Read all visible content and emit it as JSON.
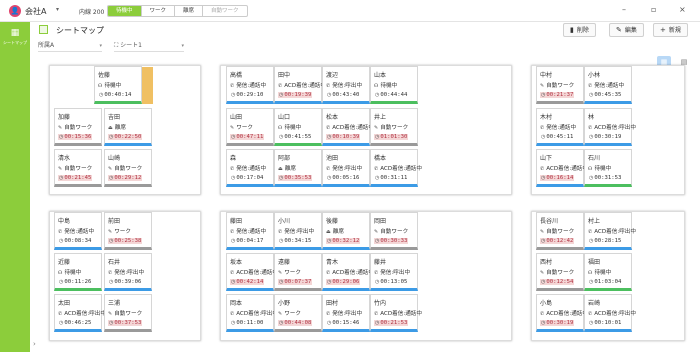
{
  "topbar": {
    "company_icon": "person-icon",
    "company_name": "会社A",
    "company_caret": "▾",
    "extension": "内線 200",
    "status_tabs": [
      "待機中",
      "ワーク",
      "離席",
      "自動ワーク"
    ],
    "active_status": "待機中",
    "window_buttons": [
      "–",
      "▫",
      "×"
    ]
  },
  "rail": {
    "label": "シートマップ",
    "icon": "grid-icon"
  },
  "header": {
    "title": "シートマップ",
    "buttons": [
      {
        "label": "削除",
        "icon": "trash-icon",
        "glyph": "▮"
      },
      {
        "label": "編集",
        "icon": "pencil-icon",
        "glyph": "✎"
      },
      {
        "label": "新規",
        "icon": "plus-icon",
        "glyph": "+"
      }
    ]
  },
  "filters": {
    "group": "所属A",
    "sheet": "シート1",
    "sheet_icon": "org-icon"
  },
  "status_colors": {
    "work": "#9a9a9a",
    "talk": "#3c9be6",
    "wait": "#4cbf5f",
    "alert_bg": "#f4d6d6"
  },
  "cards": [
    {
      "name": "佐藤",
      "status": "待機中",
      "time": "00:40:14",
      "type": "wait",
      "alert": false,
      "highlight": true
    },
    {
      "name": "加藤",
      "status": "自動ワーク",
      "time": "00:15:36",
      "type": "work",
      "alert": true
    },
    {
      "name": "吉田",
      "status": "離席",
      "time": "00:22:50",
      "type": "rest",
      "alert": true
    },
    {
      "name": "清水",
      "status": "自動ワーク",
      "time": "00:21:45",
      "type": "work",
      "alert": true
    },
    {
      "name": "山崎",
      "status": "自動ワーク",
      "time": "00:29:12",
      "type": "work",
      "alert": true
    },
    {
      "name": "高橋",
      "status": "発信:通話中",
      "time": "00:29:10",
      "type": "talk",
      "alert": false
    },
    {
      "name": "田中",
      "status": "ACD着信:通話中",
      "time": "00:19:39",
      "type": "talk",
      "alert": true
    },
    {
      "name": "渡辺",
      "status": "発信:呼出中",
      "time": "00:43:40",
      "type": "talk",
      "alert": false
    },
    {
      "name": "山本",
      "status": "待機中",
      "time": "00:44:44",
      "type": "wait",
      "alert": false
    },
    {
      "name": "山田",
      "status": "ワーク",
      "time": "00:47:11",
      "type": "work",
      "alert": true
    },
    {
      "name": "山口",
      "status": "待機中",
      "time": "00:41:55",
      "type": "wait",
      "alert": false
    },
    {
      "name": "松本",
      "status": "ACD着信:通話中",
      "time": "00:10:39",
      "type": "talk",
      "alert": true
    },
    {
      "name": "井上",
      "status": "自動ワーク",
      "time": "01:01:30",
      "type": "work",
      "alert": true
    },
    {
      "name": "森",
      "status": "発信:通話中",
      "time": "00:17:04",
      "type": "talk",
      "alert": false
    },
    {
      "name": "阿部",
      "status": "離席",
      "time": "00:35:53",
      "type": "rest",
      "alert": true
    },
    {
      "name": "池田",
      "status": "発信:呼出中",
      "time": "00:05:16",
      "type": "talk",
      "alert": false
    },
    {
      "name": "橋本",
      "status": "ACD着信:通話中",
      "time": "00:31:11",
      "type": "talk",
      "alert": false
    },
    {
      "name": "中村",
      "status": "自動ワーク",
      "time": "00:21:37",
      "type": "work",
      "alert": true
    },
    {
      "name": "小林",
      "status": "発信:通話中",
      "time": "00:45:35",
      "type": "talk",
      "alert": false
    },
    {
      "name": "木村",
      "status": "発信:通話中",
      "time": "00:45:11",
      "type": "talk",
      "alert": false
    },
    {
      "name": "林",
      "status": "ACD着信:呼出中",
      "time": "00:30:19",
      "type": "talk",
      "alert": false
    },
    {
      "name": "山下",
      "status": "ACD着信:通話中",
      "time": "00:16:14",
      "type": "talk",
      "alert": true
    },
    {
      "name": "石川",
      "status": "待機中",
      "time": "00:31:53",
      "type": "wait",
      "alert": false
    },
    {
      "name": "中島",
      "status": "発信:通話中",
      "time": "00:08:34",
      "type": "talk",
      "alert": false
    },
    {
      "name": "前田",
      "status": "ワーク",
      "time": "00:25:38",
      "type": "work",
      "alert": true
    },
    {
      "name": "近藤",
      "status": "待機中",
      "time": "00:11:26",
      "type": "wait",
      "alert": false
    },
    {
      "name": "石井",
      "status": "発信:呼出中",
      "time": "00:39:06",
      "type": "talk",
      "alert": false
    },
    {
      "name": "太田",
      "status": "ACD着信:呼出中",
      "time": "00:46:25",
      "type": "talk",
      "alert": false
    },
    {
      "name": "三浦",
      "status": "自動ワーク",
      "time": "00:37:53",
      "type": "work",
      "alert": true
    },
    {
      "name": "藤田",
      "status": "発信:通話中",
      "time": "00:04:17",
      "type": "talk",
      "alert": false
    },
    {
      "name": "小川",
      "status": "発信:呼出中",
      "time": "00:34:15",
      "type": "talk",
      "alert": false
    },
    {
      "name": "後藤",
      "status": "離席",
      "time": "00:32:12",
      "type": "rest",
      "alert": true
    },
    {
      "name": "岡田",
      "status": "自動ワーク",
      "time": "00:30:33",
      "type": "work",
      "alert": true
    },
    {
      "name": "坂本",
      "status": "ACD着信:通話中",
      "time": "00:42:14",
      "type": "talk",
      "alert": true
    },
    {
      "name": "遠藤",
      "status": "ワーク",
      "time": "00:07:37",
      "type": "work",
      "alert": true
    },
    {
      "name": "青木",
      "status": "ACD着信:通話中",
      "time": "00:29:06",
      "type": "talk",
      "alert": true
    },
    {
      "name": "藤井",
      "status": "発信:呼出中",
      "time": "00:13:05",
      "type": "talk",
      "alert": false
    },
    {
      "name": "岡本",
      "status": "ACD着信:呼出中",
      "time": "00:11:00",
      "type": "talk",
      "alert": false
    },
    {
      "name": "小野",
      "status": "ワーク",
      "time": "00:44:08",
      "type": "work",
      "alert": true
    },
    {
      "name": "田村",
      "status": "発信:呼出中",
      "time": "00:15:46",
      "type": "talk",
      "alert": false
    },
    {
      "name": "竹内",
      "status": "ACD着信:通話中",
      "time": "00:21:53",
      "type": "talk",
      "alert": true
    },
    {
      "name": "長谷川",
      "status": "自動ワーク",
      "time": "00:12:42",
      "type": "work",
      "alert": true
    },
    {
      "name": "村上",
      "status": "ACD着信:呼出中",
      "time": "00:28:15",
      "type": "talk",
      "alert": false
    },
    {
      "name": "西村",
      "status": "自動ワーク",
      "time": "00:12:54",
      "type": "work",
      "alert": true
    },
    {
      "name": "福田",
      "status": "待機中",
      "time": "01:03:04",
      "type": "wait",
      "alert": false
    },
    {
      "name": "小島",
      "status": "ACD着信:通話中",
      "time": "00:30:19",
      "type": "talk",
      "alert": true
    },
    {
      "name": "岩崎",
      "status": "ACD着信:呼出中",
      "time": "00:10:01",
      "type": "talk",
      "alert": false
    }
  ]
}
